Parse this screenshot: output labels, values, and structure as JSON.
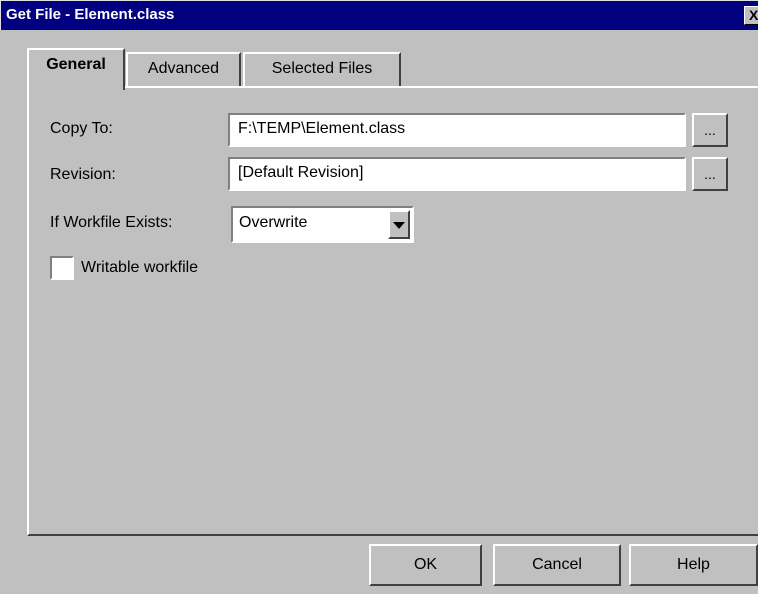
{
  "window": {
    "title": "Get File - Element.class",
    "close_label": "X"
  },
  "tabs": [
    {
      "label": "General",
      "active": true
    },
    {
      "label": "Advanced",
      "active": false
    },
    {
      "label": "Selected Files",
      "active": false
    }
  ],
  "form": {
    "copy_to": {
      "label": "Copy To:",
      "value": "F:\\TEMP\\Element.class",
      "browse_label": "..."
    },
    "revision": {
      "label": "Revision:",
      "value": "[Default Revision]",
      "browse_label": "..."
    },
    "workfile_exists": {
      "label": "If Workfile Exists:",
      "selected": "Overwrite"
    },
    "writable_workfile": {
      "label": "Writable workfile",
      "checked": false
    }
  },
  "buttons": {
    "ok": "OK",
    "cancel": "Cancel",
    "help": "Help"
  },
  "colors": {
    "titlebar": "#000080",
    "face": "#c0c0c0"
  }
}
